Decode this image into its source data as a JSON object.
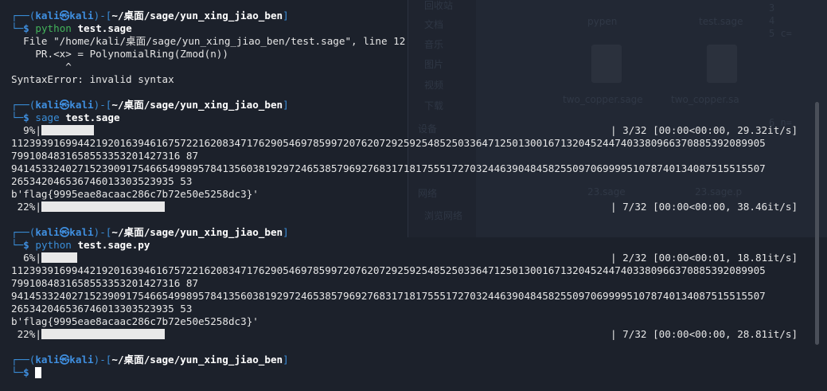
{
  "terminal": {
    "prompt_user": "kali",
    "prompt_at": "㉿",
    "prompt_host": "kali",
    "prompt_path": "~/桌面/sage/yun_xing_jiao_ben",
    "prompt_symbol": "$",
    "blocks": [
      {
        "cmd": "python",
        "arg": "test.sage",
        "output": [
          "  File \"/home/kali/桌面/sage/yun_xing_jiao_ben/test.sage\", line 12",
          "    PR.<x> = PolynomialRing(Zmod(n))",
          "         ^",
          "SyntaxError: invalid syntax"
        ]
      },
      {
        "cmd": "sage",
        "arg": "test.sage",
        "progress1_pct": "  9%|",
        "progress1_fill": 0.09,
        "progress1_stats": "| 3/32 [00:00<00:00, 29.32it/s]",
        "numbers": [
          "112393916994421920163946167572216208347176290546978599720762072925925485250336471250130016713204524474033809663708853920899057991084831658553353201427316 87",
          "941453324027152390917546654998957841356038192972465385796927683171817555172703244639048458255097069999510787401340875155155072653420465367460133035239355 3"
        ],
        "num_lines": [
          "11239391699442192016394616757221620834717629054697859972076207292592548525033647125013001671320452447403380966370885392089905",
          "7991084831658553353201427316 87",
          "94145332402715239091754665499895784135603819297246538579692768317181755517270324463904845825509706999951078740134087515515507",
          "265342046536746013303523935 53"
        ],
        "flag": "b'flag{9995eae8acaac286c7b72e50e5258dc3}'",
        "progress2_pct": " 22%|",
        "progress2_fill": 0.22,
        "progress2_stats": "| 7/32 [00:00<00:00, 38.46it/s]"
      },
      {
        "cmd": "python",
        "arg": "test.sage.py",
        "progress1_pct": "  6%|",
        "progress1_fill": 0.06,
        "progress1_stats": "| 2/32 [00:00<00:01, 18.81it/s]",
        "num_lines": [
          "11239391699442192016394616757221620834717629054697859972076207292592548525033647125013001671320452447403380966370885392089905",
          "7991084831658553353201427316 87",
          "94145332402715239091754665499895784135603819297246538579692768317181755517270324463904845825509706999951078740134087515515507",
          "265342046536746013303523935 53"
        ],
        "flag": "b'flag{9995eae8acaac286c7b72e50e5258dc3}'",
        "progress2_pct": " 22%|",
        "progress2_fill": 0.22,
        "progress2_stats": "| 7/32 [00:00<00:00, 28.81it/s]"
      }
    ]
  },
  "background": {
    "sidebar_items": [
      "回收站",
      "文档",
      "音乐",
      "图片",
      "视频",
      "下载",
      "设备",
      "网络",
      "浏览网络"
    ],
    "files": [
      "pypen",
      "test.sage",
      "two_copper.sage",
      "two_copper.sa",
      "23.sage",
      "23.sage.p"
    ],
    "side_code": [
      "3",
      "4",
      "5 c=",
      "6 n="
    ]
  }
}
